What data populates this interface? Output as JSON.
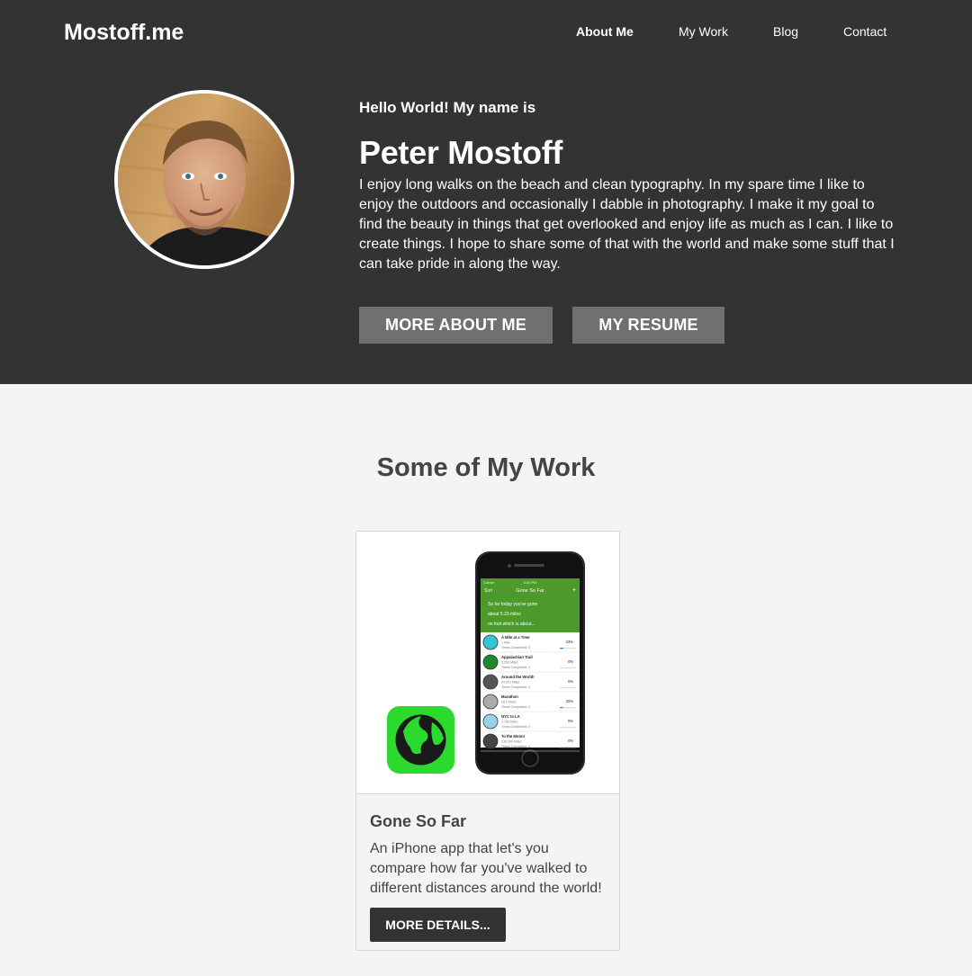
{
  "header": {
    "brand": "Mostoff.me",
    "nav": [
      {
        "label": "About Me",
        "active": true
      },
      {
        "label": "My Work",
        "active": false
      },
      {
        "label": "Blog",
        "active": false
      },
      {
        "label": "Contact",
        "active": false
      }
    ]
  },
  "hero": {
    "greeting": "Hello World! My name is",
    "name": "Peter Mostoff",
    "bio": "I enjoy long walks on the beach and clean typography. In my spare time I like to enjoy the outdoors and occasionally I dabble in photography. I make it my goal to find the beauty in things that get overlooked and enjoy life as much as I can. I like to create things. I hope to share some of that with the world and make some stuff that I can take pride in along the way.",
    "buttons": {
      "more_about": "MORE ABOUT ME",
      "resume": "MY RESUME"
    }
  },
  "work": {
    "title": "Some of My Work",
    "projects": [
      {
        "title": "Gone So Far",
        "description": "An iPhone app that let's you compare how far you've walked to different distances around the world!",
        "button": "MORE DETAILS...",
        "app_screen": {
          "status_left": "Carrier",
          "status_time": "3:20 PM",
          "nav_left": "Sort",
          "nav_title": "Gone So Far",
          "nav_right": "+",
          "summary_line1": "So far today you've gone",
          "summary_line2": "about 5.23 miles",
          "summary_line3": "on foot which is about...",
          "items": [
            {
              "name": "A Mile at a Time",
              "distance": "1 Mile",
              "times": "Times Completed: 5",
              "percent": "23%",
              "progress": 0.23,
              "icon": "shoe-icon",
              "icon_color": "#35c3d6"
            },
            {
              "name": "Appalachian Trail",
              "distance": "2,200 Miles",
              "times": "Times Completed: 0",
              "percent": "0%",
              "progress": 0.0,
              "icon": "tree-icon",
              "icon_color": "#1d8a2c"
            },
            {
              "name": "Around the World!",
              "distance": "24,901 Miles",
              "times": "Times Completed: 0",
              "percent": "0%",
              "progress": 0.0,
              "icon": "globe-icon",
              "icon_color": "#555555"
            },
            {
              "name": "Marathon",
              "distance": "26.2 Miles",
              "times": "Times Completed: 0",
              "percent": "20%",
              "progress": 0.2,
              "icon": "runner-icon",
              "icon_color": "#aaaaaa"
            },
            {
              "name": "NYC to LA",
              "distance": "2,789 Miles",
              "times": "Times Completed: 0",
              "percent": "0%",
              "progress": 0.0,
              "icon": "map-icon",
              "icon_color": "#9ad0e6"
            },
            {
              "name": "To the Moon!",
              "distance": "238,900 Miles",
              "times": "Times Completed: 0",
              "percent": "0%",
              "progress": 0.0,
              "icon": "moon-icon",
              "icon_color": "#444444"
            }
          ]
        }
      }
    ]
  },
  "colors": {
    "header_bg": "#333333",
    "button_gray": "#707070",
    "app_green": "#4c9a2a",
    "app_icon_green": "#2bd92f"
  }
}
